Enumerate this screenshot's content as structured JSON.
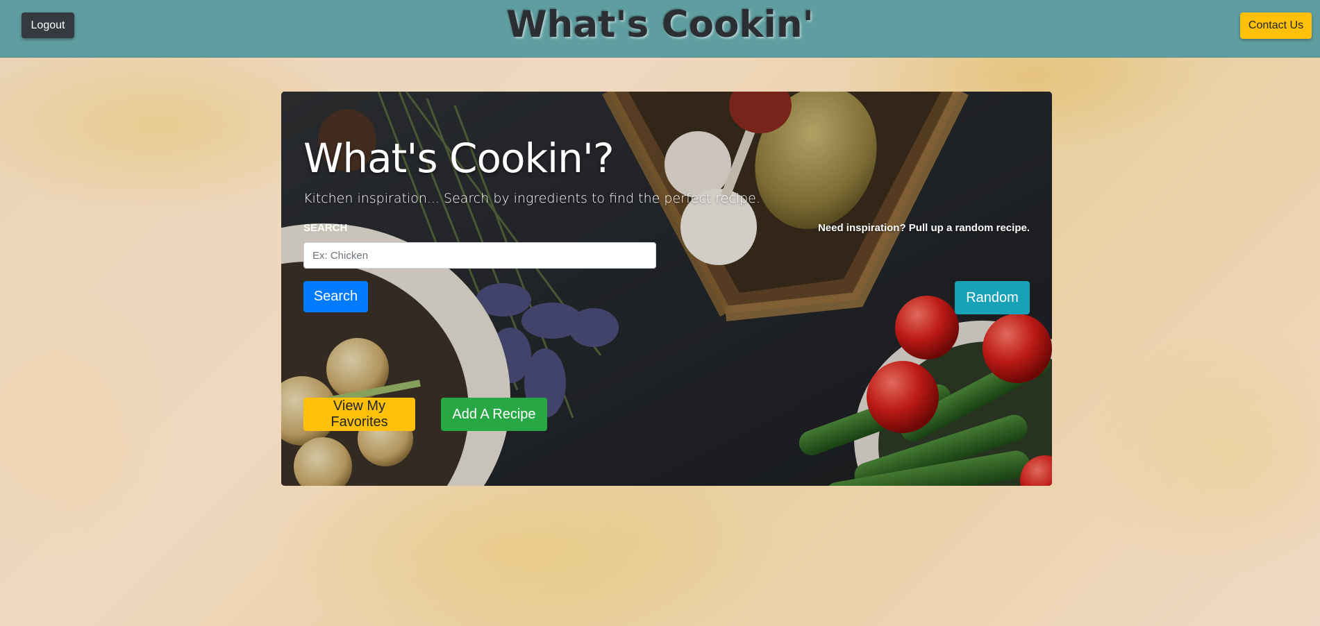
{
  "navbar": {
    "title": "What's Cookin'",
    "logout_label": "Logout",
    "contact_label": "Contact Us",
    "background_color": "#5f9ea0"
  },
  "hero": {
    "title": "What's Cookin'?",
    "subtitle": "Kitchen inspiration... Search by ingredients to find the perfect recipe.",
    "search_label": "SEARCH",
    "search_placeholder": "Ex: Chicken",
    "search_value": "",
    "search_button": "Search",
    "random_prompt": "Need inspiration? Pull up a random recipe.",
    "random_button": "Random",
    "favorites_button": "View My Favorites",
    "add_recipe_button": "Add A Recipe"
  },
  "colors": {
    "primary": "#007bff",
    "info": "#17a2b8",
    "warning": "#ffc107",
    "success": "#28a745",
    "dark": "#343a40"
  }
}
